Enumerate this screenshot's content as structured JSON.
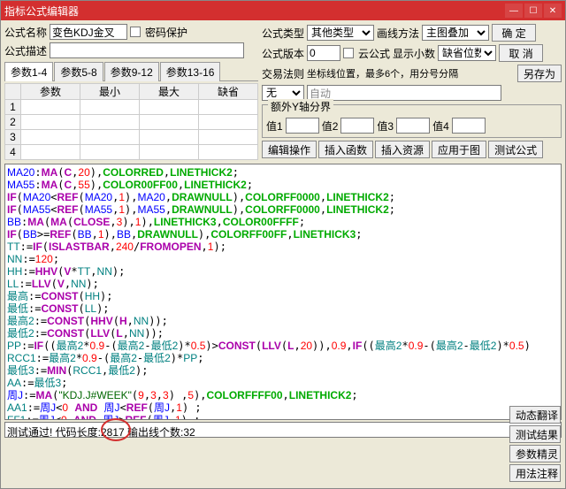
{
  "window": {
    "title": "指标公式编辑器",
    "min": "—",
    "max": "☐",
    "close": "✕"
  },
  "left": {
    "name_lbl": "公式名称",
    "name_val": "变色KDJ金叉",
    "pwd_lbl": "密码保护",
    "desc_lbl": "公式描述",
    "desc_val": "",
    "tabs": [
      "参数1-4",
      "参数5-8",
      "参数9-12",
      "参数13-16"
    ],
    "hdr": {
      "p": "参数",
      "mn": "最小",
      "mx": "最大",
      "df": "缺省"
    },
    "rows": [
      "1",
      "2",
      "3",
      "4"
    ]
  },
  "right": {
    "type_lbl": "公式类型",
    "type_val": "其他类型",
    "draw_lbl": "画线方法",
    "draw_val": "主图叠加",
    "ver_lbl": "公式版本",
    "ver_val": "0",
    "cloud_lbl": "云公式",
    "dec_lbl": "显示小数",
    "dec_field": "缺省位数",
    "rule_lbl": "交易法则",
    "coord_lbl": "坐标线位置，最多6个，用分号分隔",
    "rule_val": "无",
    "auto": "自动",
    "extra_lbl": "额外Y轴分界",
    "v1": "值1",
    "v2": "值2",
    "v3": "值3",
    "v4": "值4",
    "ok": "确 定",
    "cancel": "取 消",
    "save": "另存为",
    "b1": "编辑操作",
    "b2": "插入函数",
    "b3": "插入资源",
    "b4": "应用于图",
    "b5": "测试公式"
  },
  "status": {
    "text": "测试通过! 代码长度:2817 输出线个数:32"
  },
  "side": {
    "b1": "动态翻译",
    "b2": "测试结果",
    "b3": "参数精灵",
    "b4": "用法注释"
  }
}
